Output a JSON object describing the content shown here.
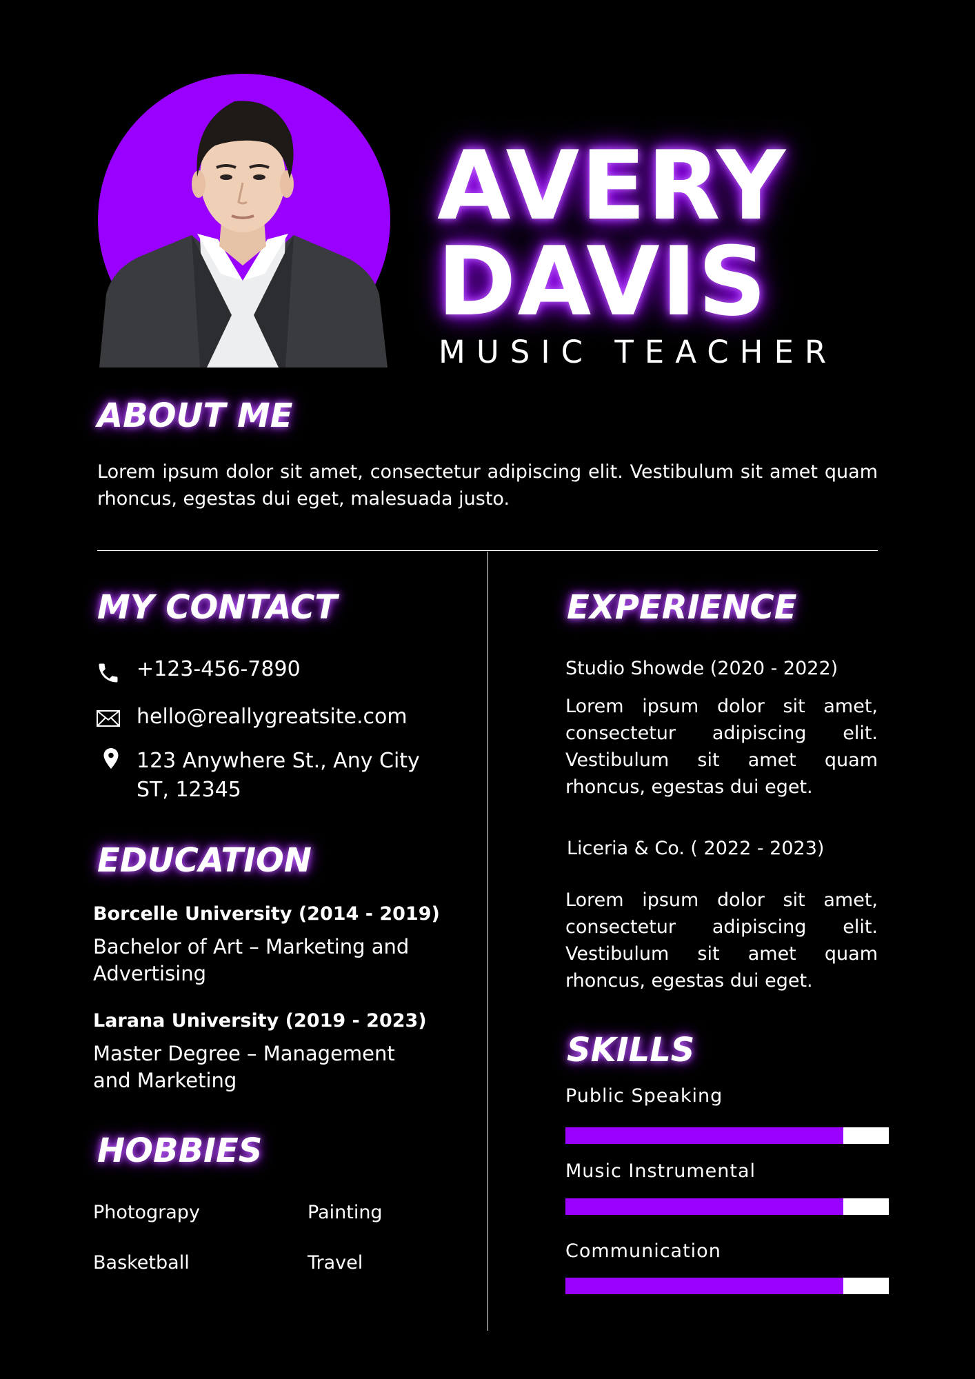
{
  "header": {
    "first_name": "AVERY",
    "last_name": "DAVIS",
    "job_title": "MUSIC TEACHER"
  },
  "about": {
    "heading": "ABOUT ME",
    "text": "Lorem ipsum dolor sit amet, consectetur adipiscing elit. Vestibulum sit amet quam rhoncus, egestas dui eget, malesuada justo."
  },
  "contact": {
    "heading": "MY CONTACT",
    "phone": "+123-456-7890",
    "email": "hello@reallygreatsite.com",
    "address_line1": "123 Anywhere St., Any City",
    "address_line2": "ST, 12345",
    "icons": [
      "phone-icon",
      "mail-icon",
      "location-pin-icon"
    ]
  },
  "education": {
    "heading": "EDUCATION",
    "items": [
      {
        "school": "Borcelle University (2014 - 2019)",
        "degree": "Bachelor of Art – Marketing and Advertising"
      },
      {
        "school": "Larana University (2019 - 2023)",
        "degree": "Master Degree – Management and Marketing"
      }
    ]
  },
  "hobbies": {
    "heading": "HOBBIES",
    "items": [
      "Photograpy",
      "Painting",
      "Basketball",
      "Travel"
    ]
  },
  "experience": {
    "heading": "EXPERIENCE",
    "items": [
      {
        "title": "Studio Showde (2020 - 2022)",
        "text": "Lorem ipsum dolor sit amet, consectetur adipiscing elit. Vestibulum sit amet quam rhoncus, egestas dui eget."
      },
      {
        "title": "Liceria & Co. ( 2022 - 2023)",
        "text": "Lorem ipsum dolor sit amet, consectetur adipiscing elit. Vestibulum sit amet quam rhoncus, egestas dui eget."
      }
    ]
  },
  "skills": {
    "heading": "SKILLS",
    "items": [
      {
        "name": "Public Speaking",
        "level": 0.86
      },
      {
        "name": "Music Instrumental",
        "level": 0.86
      },
      {
        "name": "Communication",
        "level": 0.86
      }
    ]
  },
  "colors": {
    "accent": "#9900ff",
    "glow": "#c36bff",
    "background": "#000000",
    "text": "#ffffff"
  }
}
